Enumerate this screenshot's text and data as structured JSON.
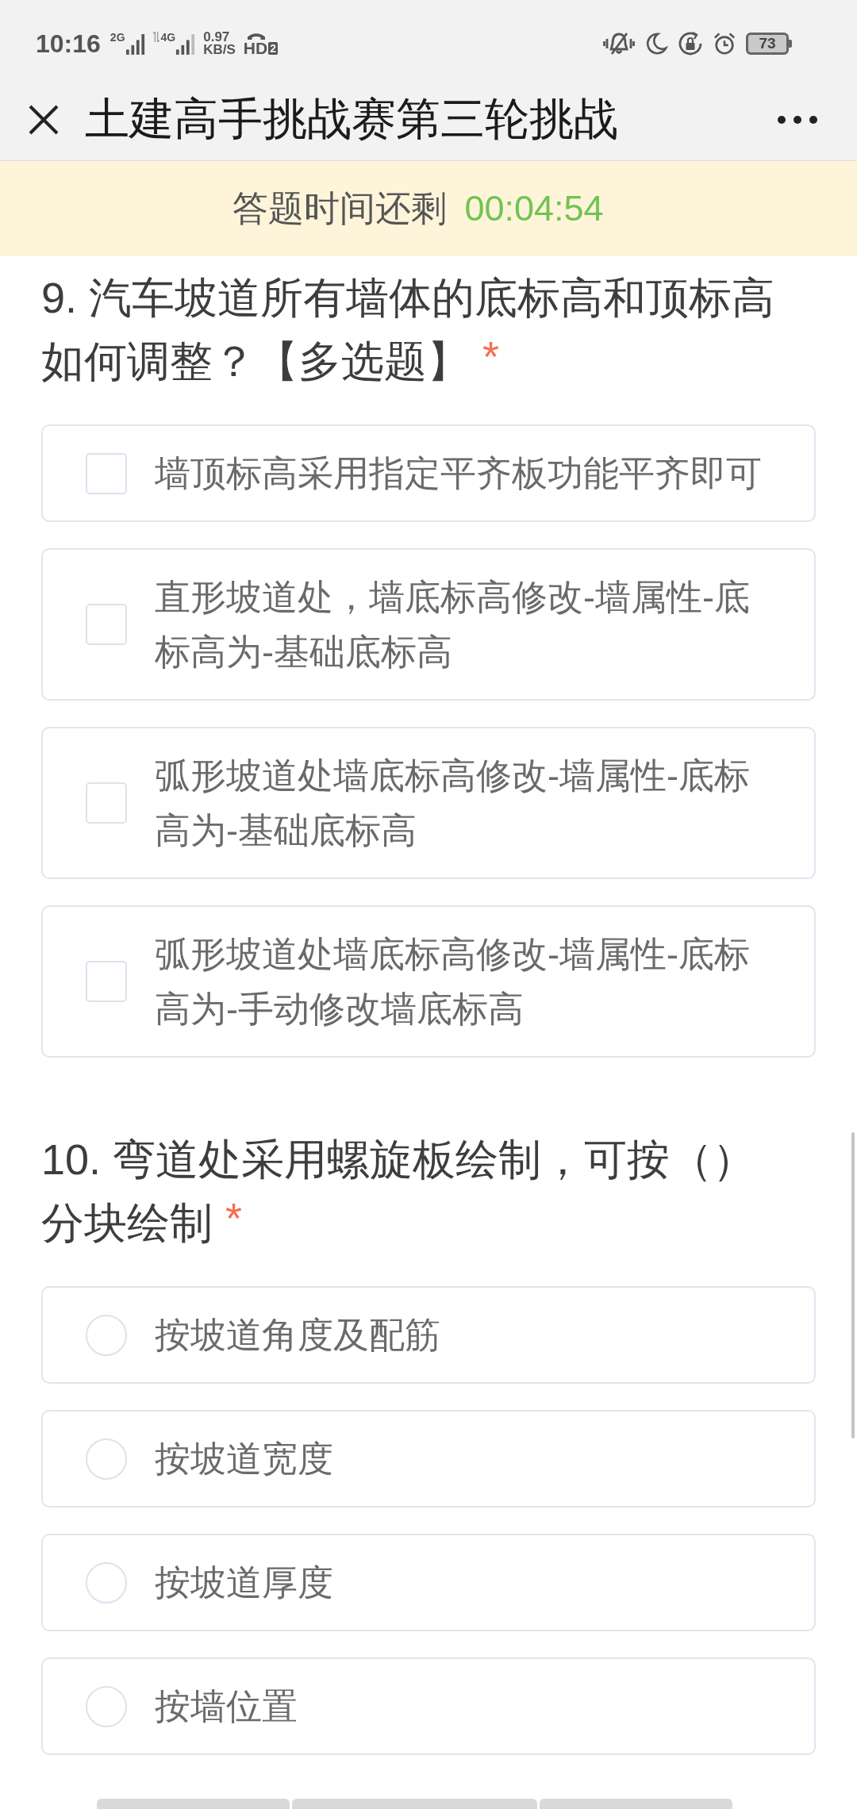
{
  "status_bar": {
    "time": "10:16",
    "sim1_network": "2G",
    "sim2_network": "4G",
    "speed_value": "0.97",
    "speed_unit": "KB/S",
    "hd_label": "HD",
    "hd_sim": "2",
    "battery": "73"
  },
  "header": {
    "title": "土建高手挑战赛第三轮挑战"
  },
  "timer_banner": {
    "label": "答题时间还剩",
    "remaining": "00:04:54"
  },
  "questions": [
    {
      "title": "9. 汽车坡道所有墙体的底标高和顶标高如何调整？【多选题】",
      "required_mark": "*",
      "kind": "checkbox",
      "options": [
        {
          "label": "墙顶标高采用指定平齐板功能平齐即可",
          "selected": false
        },
        {
          "label": "直形坡道处，墙底标高修改-墙属性-底标高为-基础底标高",
          "selected": false
        },
        {
          "label": "弧形坡道处墙底标高修改-墙属性-底标高为-基础底标高",
          "selected": false
        },
        {
          "label": "弧形坡道处墙底标高修改-墙属性-底标高为-手动修改墙底标高",
          "selected": false
        }
      ]
    },
    {
      "title": "10. 弯道处采用螺旋板绘制，可按（）分块绘制",
      "required_mark": "*",
      "kind": "radio",
      "options": [
        {
          "label": "按坡道角度及配筋",
          "selected": false
        },
        {
          "label": "按坡道宽度",
          "selected": false
        },
        {
          "label": "按坡道厚度",
          "selected": false
        },
        {
          "label": "按墙位置",
          "selected": false
        }
      ]
    }
  ]
}
